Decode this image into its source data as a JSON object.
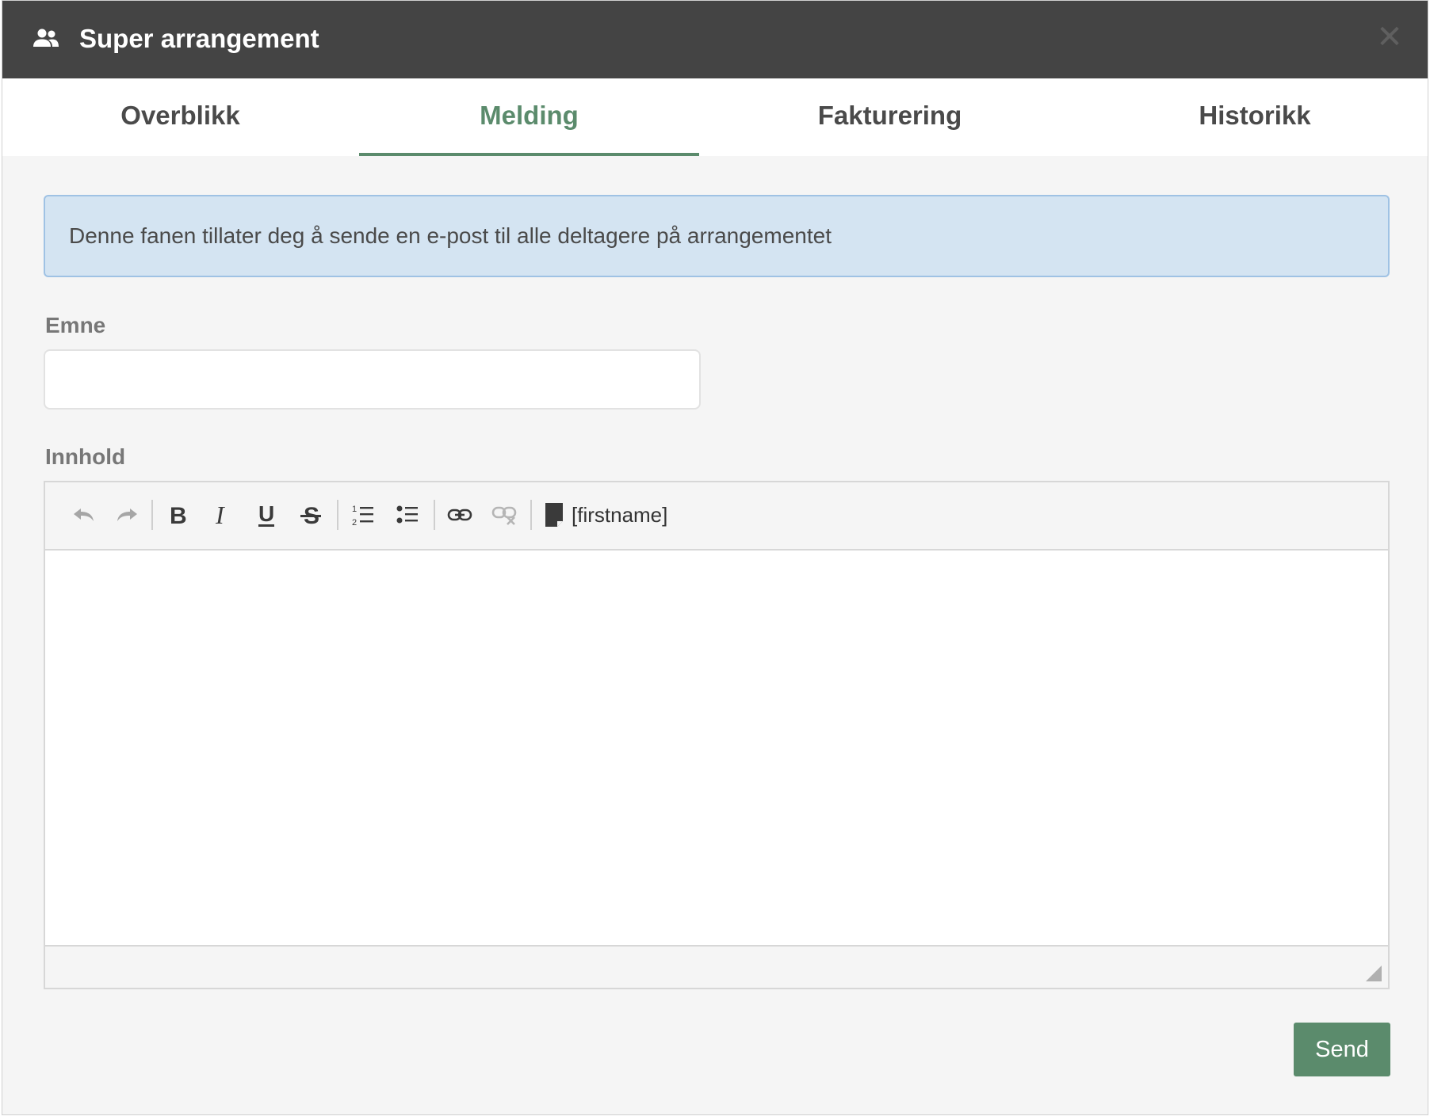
{
  "header": {
    "title": "Super arrangement",
    "icon": "people-icon",
    "close_icon": "close-icon",
    "background_color": "#444444"
  },
  "tabs": [
    {
      "label": "Overblikk",
      "active": false
    },
    {
      "label": "Melding",
      "active": true
    },
    {
      "label": "Fakturering",
      "active": false
    },
    {
      "label": "Historikk",
      "active": false
    }
  ],
  "accent_color": "#5b8b6c",
  "info": {
    "text": "Denne fanen tillater deg å sende en e-post til alle deltagere på arrangementet"
  },
  "subject": {
    "label": "Emne",
    "value": "",
    "placeholder": ""
  },
  "content": {
    "label": "Innhold",
    "toolbar": {
      "buttons": [
        "undo-icon",
        "redo-icon",
        "bold-icon",
        "italic-icon",
        "underline-icon",
        "strikethrough-icon",
        "numbered-list-icon",
        "bullet-list-icon",
        "link-icon",
        "unlink-icon",
        "document-icon"
      ],
      "placeholder_label": "[firstname]"
    },
    "value": ""
  },
  "actions": {
    "send_label": "Send"
  }
}
